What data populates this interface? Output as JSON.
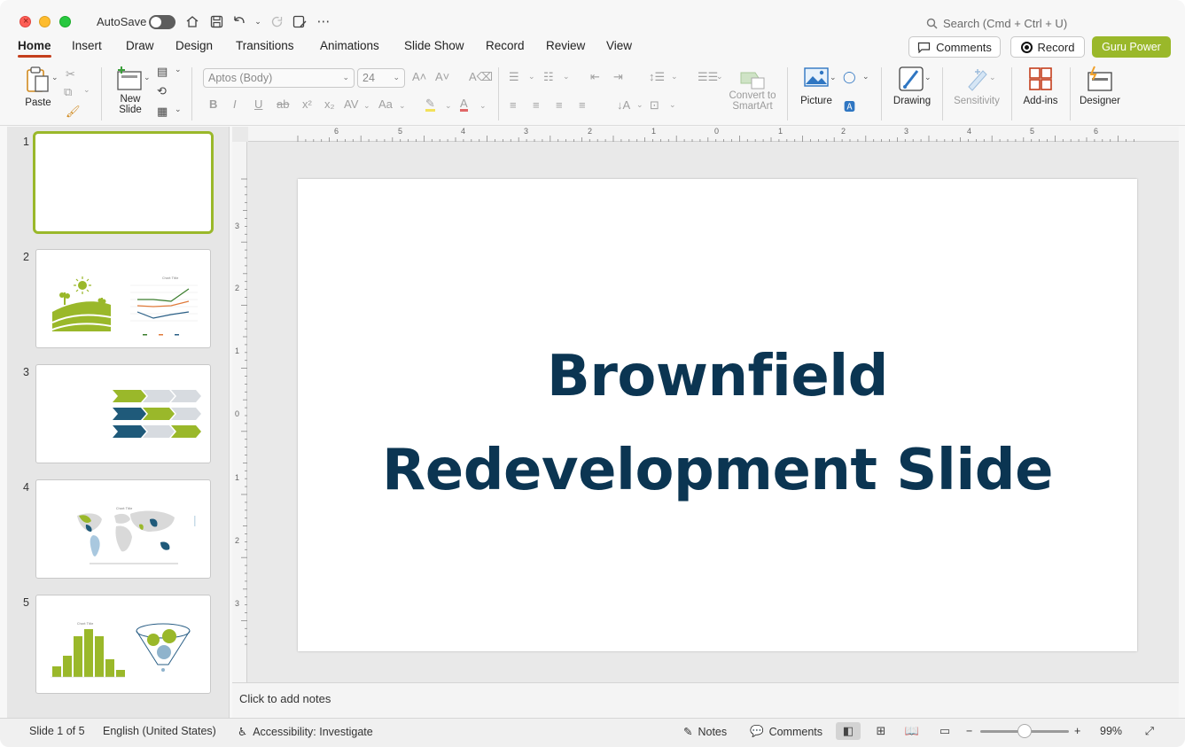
{
  "titlebar": {
    "autosave_label": "AutoSave",
    "search_placeholder": "Search (Cmd + Ctrl + U)"
  },
  "tabs": [
    "Home",
    "Insert",
    "Draw",
    "Design",
    "Transitions",
    "Animations",
    "Slide Show",
    "Record",
    "Review",
    "View"
  ],
  "active_tab": "Home",
  "header_buttons": {
    "comments": "Comments",
    "record": "Record",
    "guru": "Guru Power"
  },
  "ribbon": {
    "paste": "Paste",
    "new_slide": "New\nSlide",
    "font_name": "Aptos (Body)",
    "font_size": "24",
    "convert_smartart": "Convert to\nSmartArt",
    "picture": "Picture",
    "drawing": "Drawing",
    "sensitivity": "Sensitivity",
    "addins": "Add-ins",
    "designer": "Designer"
  },
  "thumbnails": [
    {
      "number": "1"
    },
    {
      "number": "2",
      "chart_title": "Chart Title"
    },
    {
      "number": "3"
    },
    {
      "number": "4",
      "chart_title": "Chart Title"
    },
    {
      "number": "5",
      "chart_title": "Chart Title"
    }
  ],
  "ruler": {
    "horizontal": [
      "6",
      "5",
      "4",
      "3",
      "2",
      "1",
      "0",
      "1",
      "2",
      "3",
      "4",
      "5",
      "6"
    ],
    "vertical": [
      "3",
      "2",
      "1",
      "0",
      "1",
      "2",
      "3"
    ]
  },
  "slide": {
    "title_line1": "Brownfield",
    "title_line2": "Redevelopment Slide"
  },
  "notes_placeholder": "Click to add notes",
  "status": {
    "slide_info": "Slide 1 of 5",
    "language": "English (United States)",
    "accessibility": "Accessibility: Investigate",
    "notes": "Notes",
    "comments": "Comments",
    "zoom": "99%"
  },
  "colors": {
    "accent_green": "#9ab82a",
    "title_navy": "#0b3552",
    "tab_underline": "#c43e1c",
    "dark_teal": "#1f5a7a"
  }
}
